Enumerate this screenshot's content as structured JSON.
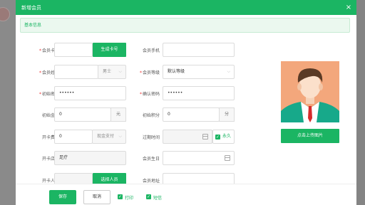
{
  "modal": {
    "title": "新增会员",
    "close_icon": "×"
  },
  "section": {
    "label": "基本信息"
  },
  "form": {
    "card_no": {
      "label": "会员卡号",
      "value": "",
      "button": "生成卡号"
    },
    "mobile": {
      "label": "会员手机",
      "value": ""
    },
    "name": {
      "label": "会员姓名",
      "value": "",
      "title_select": "男士"
    },
    "level": {
      "label": "会员等级",
      "value": "默认等级"
    },
    "init_password": {
      "label": "初始密码",
      "value": "••••••"
    },
    "confirm_password": {
      "label": "确认密码",
      "value": "••••••"
    },
    "init_amount": {
      "label": "初始金额",
      "value": "0",
      "unit": "元"
    },
    "init_points": {
      "label": "初始积分",
      "value": "0",
      "unit": "分"
    },
    "card_fee": {
      "label": "开卡费用",
      "value": "0",
      "pay_method": "现金支付"
    },
    "expire_time": {
      "label": "过期时间",
      "value": "",
      "permanent_label": "永久",
      "permanent_checked": true
    },
    "store": {
      "label": "开卡店铺",
      "value": "足疗"
    },
    "birthday": {
      "label": "会员生日",
      "value": ""
    },
    "staff": {
      "label": "开卡人员",
      "value": "",
      "button": "选择人员"
    },
    "address": {
      "label": "会员地址",
      "value": ""
    }
  },
  "photo": {
    "upload_label": "点击上传图片"
  },
  "footer": {
    "save_label": "保存",
    "cancel_label": "取消",
    "print_label": "打印",
    "print_checked": true,
    "sms_label": "短信",
    "sms_checked": true
  },
  "colors": {
    "accent": "#1bb563",
    "required": "#ee3333"
  }
}
